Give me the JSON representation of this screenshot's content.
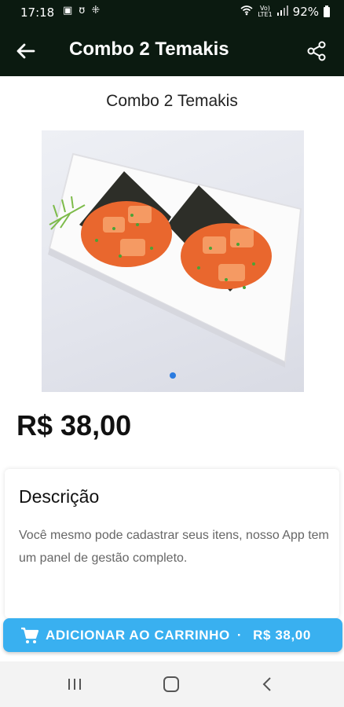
{
  "status_bar": {
    "time": "17:18",
    "network": "Vo)\nLTE1",
    "battery": "92%"
  },
  "app_bar": {
    "title": "Combo 2 Temakis"
  },
  "product": {
    "name": "Combo 2 Temakis",
    "price": "R$ 38,00",
    "image_pager": {
      "count": 1,
      "active": 0
    }
  },
  "description": {
    "heading": "Descrição",
    "text": "Você mesmo pode cadastrar seus itens, nosso App tem um panel de gestão completo."
  },
  "cart_button": {
    "label": "ADICIONAR AO CARRINHO",
    "separator": "·",
    "price": "R$ 38,00"
  },
  "colors": {
    "app_bar": "#0b1a10",
    "accent": "#39b0f0",
    "pager_dot": "#2b7be0"
  },
  "icons": [
    "back-arrow-icon",
    "share-icon",
    "cart-icon",
    "recents-icon",
    "home-icon",
    "back-nav-icon"
  ]
}
